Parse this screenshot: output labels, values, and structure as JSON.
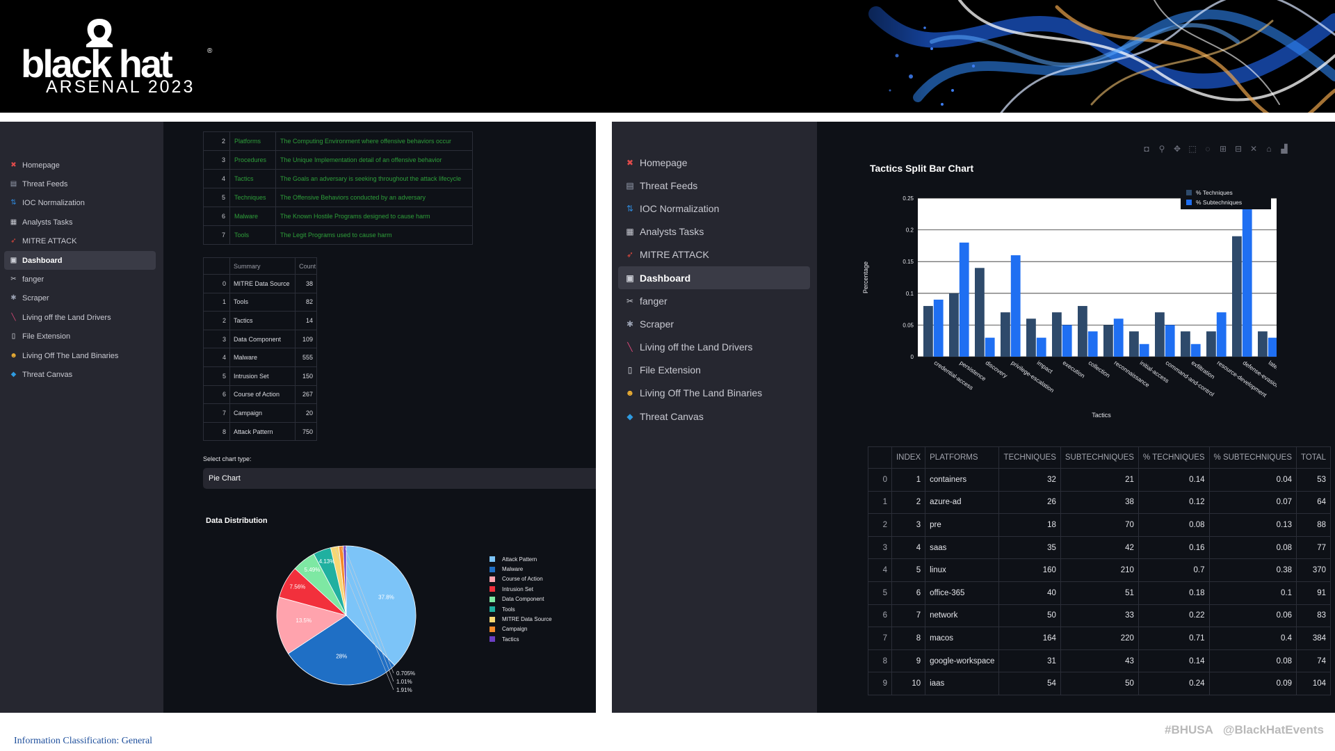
{
  "banner": {
    "logo_wordmark": "black hat",
    "logo_reg": "®",
    "logo_subtitle": "ARSENAL 2023"
  },
  "sidebar": {
    "items": [
      {
        "label": "Homepage",
        "icon": "house-icon",
        "color": "#e04b4b"
      },
      {
        "label": "Threat Feeds",
        "icon": "document-icon",
        "color": "#9aa1b2"
      },
      {
        "label": "IOC Normalization",
        "icon": "ioc-icon",
        "color": "#2f86d6"
      },
      {
        "label": "Analysts Tasks",
        "icon": "notepad-icon",
        "color": "#c9cbd3"
      },
      {
        "label": "MITRE ATTACK",
        "icon": "rocket-icon",
        "color": "#e2483d"
      },
      {
        "label": "Dashboard",
        "icon": "dashboard-icon",
        "color": "#c9cbd3",
        "active": true
      },
      {
        "label": "fanger",
        "icon": "tool-icon",
        "color": "#c9cbd3"
      },
      {
        "label": "Scraper",
        "icon": "spider-icon",
        "color": "#9aa1b2"
      },
      {
        "label": "Living off the Land Drivers",
        "icon": "driver-icon",
        "color": "#e0497a"
      },
      {
        "label": "File Extension",
        "icon": "file-icon",
        "color": "#dfe1e8"
      },
      {
        "label": "Living Off The Land Binaries",
        "icon": "face-icon",
        "color": "#f2b233"
      },
      {
        "label": "Threat Canvas",
        "icon": "diamond-icon",
        "color": "#2f9be0"
      }
    ]
  },
  "glossary": {
    "rows": [
      {
        "index": "2",
        "term": "Platforms",
        "description": "The Computing Environment where offensive behaviors occur"
      },
      {
        "index": "3",
        "term": "Procedures",
        "description": "The Unique Implementation detail of an offensive behavior"
      },
      {
        "index": "4",
        "term": "Tactics",
        "description": "The Goals an adversary is seeking throughout the attack lifecycle"
      },
      {
        "index": "5",
        "term": "Techniques",
        "description": "The Offensive Behaviors conducted by an adversary"
      },
      {
        "index": "6",
        "term": "Malware",
        "description": "The Known Hostile Programs designed to cause harm"
      },
      {
        "index": "7",
        "term": "Tools",
        "description": "The Legit Programs used to cause harm"
      }
    ]
  },
  "summary": {
    "headers": [
      "Summary",
      "Count"
    ],
    "rows": [
      {
        "index": "0",
        "name": "MITRE Data Source",
        "count": "38"
      },
      {
        "index": "1",
        "name": "Tools",
        "count": "82"
      },
      {
        "index": "2",
        "name": "Tactics",
        "count": "14"
      },
      {
        "index": "3",
        "name": "Data Component",
        "count": "109"
      },
      {
        "index": "4",
        "name": "Malware",
        "count": "555"
      },
      {
        "index": "5",
        "name": "Intrusion Set",
        "count": "150"
      },
      {
        "index": "6",
        "name": "Course of Action",
        "count": "267"
      },
      {
        "index": "7",
        "name": "Campaign",
        "count": "20"
      },
      {
        "index": "8",
        "name": "Attack Pattern",
        "count": "750"
      }
    ]
  },
  "chart_select": {
    "label": "Select chart type:",
    "value": "Pie Chart"
  },
  "chart_data": [
    {
      "type": "pie",
      "title": "Data Distribution",
      "slices": [
        {
          "label": "Attack Pattern",
          "value": 37.8,
          "color": "#7cc4f8",
          "text": "37.8%"
        },
        {
          "label": "Malware",
          "value": 28.0,
          "color": "#1f6fc5",
          "text": "28%"
        },
        {
          "label": "Course of Action",
          "value": 13.5,
          "color": "#ffa3ad",
          "text": "13.5%"
        },
        {
          "label": "Intrusion Set",
          "value": 7.56,
          "color": "#f2303c",
          "text": "7.56%"
        },
        {
          "label": "Data Component",
          "value": 5.49,
          "color": "#7ee8a3",
          "text": "5.49%"
        },
        {
          "label": "Tools",
          "value": 4.13,
          "color": "#20b0a0",
          "text": "4.13%"
        },
        {
          "label": "MITRE Data Source",
          "value": 1.91,
          "color": "#f7d774",
          "text": "1.91%"
        },
        {
          "label": "Campaign",
          "value": 1.01,
          "color": "#f58a2a",
          "text": "1.01%"
        },
        {
          "label": "Tactics",
          "value": 0.705,
          "color": "#6c3fc4",
          "text": "0.705%"
        }
      ]
    },
    {
      "type": "bar",
      "title": "Tactics Split Bar Chart",
      "xlabel": "Tactics",
      "ylabel": "Percentage",
      "ylim": [
        0,
        0.25
      ],
      "yticks": [
        "0",
        "0.05",
        "0.1",
        "0.15",
        "0.2",
        "0.25"
      ],
      "legend_position": "top-right",
      "categories": [
        "credential-access",
        "persistence",
        "discovery",
        "privilege-escalation",
        "impact",
        "execution",
        "collection",
        "reconnaissance",
        "initial-access",
        "command-and-control",
        "exfiltration",
        "resource-development",
        "defense-evasion",
        "lateral-movement"
      ],
      "series": [
        {
          "name": "% Techniques",
          "color": "#2e4a6b",
          "values": [
            0.08,
            0.1,
            0.14,
            0.07,
            0.06,
            0.07,
            0.08,
            0.05,
            0.04,
            0.07,
            0.04,
            0.04,
            0.19,
            0.04
          ]
        },
        {
          "name": "% Subtechniques",
          "color": "#1f6ff2",
          "values": [
            0.09,
            0.18,
            0.03,
            0.16,
            0.03,
            0.05,
            0.04,
            0.06,
            0.02,
            0.05,
            0.02,
            0.07,
            0.27,
            0.03
          ]
        }
      ]
    }
  ],
  "toolbar": {
    "icons": [
      "camera-icon",
      "zoom-icon",
      "pan-icon",
      "box-select-icon",
      "lasso-icon",
      "zoom-in-icon",
      "zoom-out-icon",
      "autoscale-icon",
      "reset-axes-icon",
      "plotly-logo-icon"
    ]
  },
  "platforms": {
    "headers": [
      "",
      "INDEX",
      "PLATFORMS",
      "TECHNIQUES",
      "SUBTECHNIQUES",
      "% TECHNIQUES",
      "% SUBTECHNIQUES",
      "TOTAL"
    ],
    "rows": [
      [
        "0",
        "1",
        "containers",
        "32",
        "21",
        "0.14",
        "0.04",
        "53"
      ],
      [
        "1",
        "2",
        "azure-ad",
        "26",
        "38",
        "0.12",
        "0.07",
        "64"
      ],
      [
        "2",
        "3",
        "pre",
        "18",
        "70",
        "0.08",
        "0.13",
        "88"
      ],
      [
        "3",
        "4",
        "saas",
        "35",
        "42",
        "0.16",
        "0.08",
        "77"
      ],
      [
        "4",
        "5",
        "linux",
        "160",
        "210",
        "0.7",
        "0.38",
        "370"
      ],
      [
        "5",
        "6",
        "office-365",
        "40",
        "51",
        "0.18",
        "0.1",
        "91"
      ],
      [
        "6",
        "7",
        "network",
        "50",
        "33",
        "0.22",
        "0.06",
        "83"
      ],
      [
        "7",
        "8",
        "macos",
        "164",
        "220",
        "0.71",
        "0.4",
        "384"
      ],
      [
        "8",
        "9",
        "google-workspace",
        "31",
        "43",
        "0.14",
        "0.08",
        "74"
      ],
      [
        "9",
        "10",
        "iaas",
        "54",
        "50",
        "0.24",
        "0.09",
        "104"
      ]
    ]
  },
  "footer": {
    "classification": "Information Classification: General",
    "hashtag": "#BHUSA",
    "handle": "@BlackHatEvents"
  }
}
